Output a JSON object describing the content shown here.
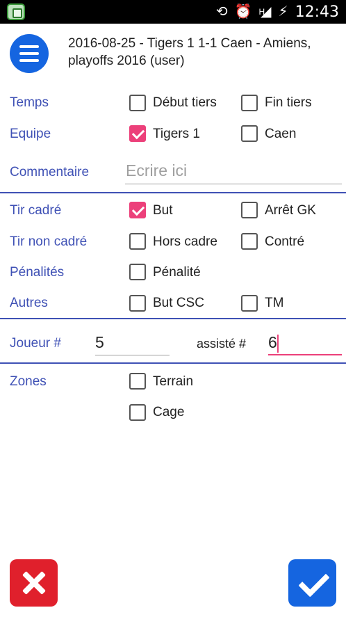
{
  "status_bar": {
    "time": "12:43",
    "network_label": "H",
    "icons": [
      "app-icon",
      "rotate-icon",
      "alarm-icon",
      "signal-icon",
      "battery-charging-icon"
    ]
  },
  "header": {
    "menu_icon": "hamburger-menu-icon",
    "title": "2016-08-25 - Tigers 1 1-1 Caen - Amiens, playoffs 2016 (user)"
  },
  "form": {
    "temps": {
      "label": "Temps",
      "options": [
        {
          "label": "Début tiers",
          "checked": false
        },
        {
          "label": "Fin tiers",
          "checked": false
        }
      ]
    },
    "equipe": {
      "label": "Equipe",
      "options": [
        {
          "label": "Tigers 1",
          "checked": true
        },
        {
          "label": "Caen",
          "checked": false
        }
      ]
    },
    "commentaire": {
      "label": "Commentaire",
      "placeholder": "Ecrire ici",
      "value": ""
    },
    "tir_cadre": {
      "label": "Tir cadré",
      "options": [
        {
          "label": "But",
          "checked": true
        },
        {
          "label": "Arrêt GK",
          "checked": false
        }
      ]
    },
    "tir_non_cadre": {
      "label": "Tir non cadré",
      "options": [
        {
          "label": "Hors cadre",
          "checked": false
        },
        {
          "label": "Contré",
          "checked": false
        }
      ]
    },
    "penalites": {
      "label": "Pénalités",
      "options": [
        {
          "label": "Pénalité",
          "checked": false
        }
      ]
    },
    "autres": {
      "label": "Autres",
      "options": [
        {
          "label": "But CSC",
          "checked": false
        },
        {
          "label": "TM",
          "checked": false
        }
      ]
    },
    "joueur": {
      "label": "Joueur #",
      "value": "5",
      "assist_label": "assisté #",
      "assist_value": "6"
    },
    "zones": {
      "label": "Zones",
      "options": [
        {
          "label": "Terrain",
          "checked": false
        },
        {
          "label": "Cage",
          "checked": false
        }
      ]
    }
  },
  "actions": {
    "cancel_icon": "close-icon",
    "confirm_icon": "checkmark-icon"
  },
  "colors": {
    "accent": "#3f51b5",
    "checked": "#ec407a",
    "primary_button": "#1565e0",
    "cancel_button": "#e0202c"
  }
}
